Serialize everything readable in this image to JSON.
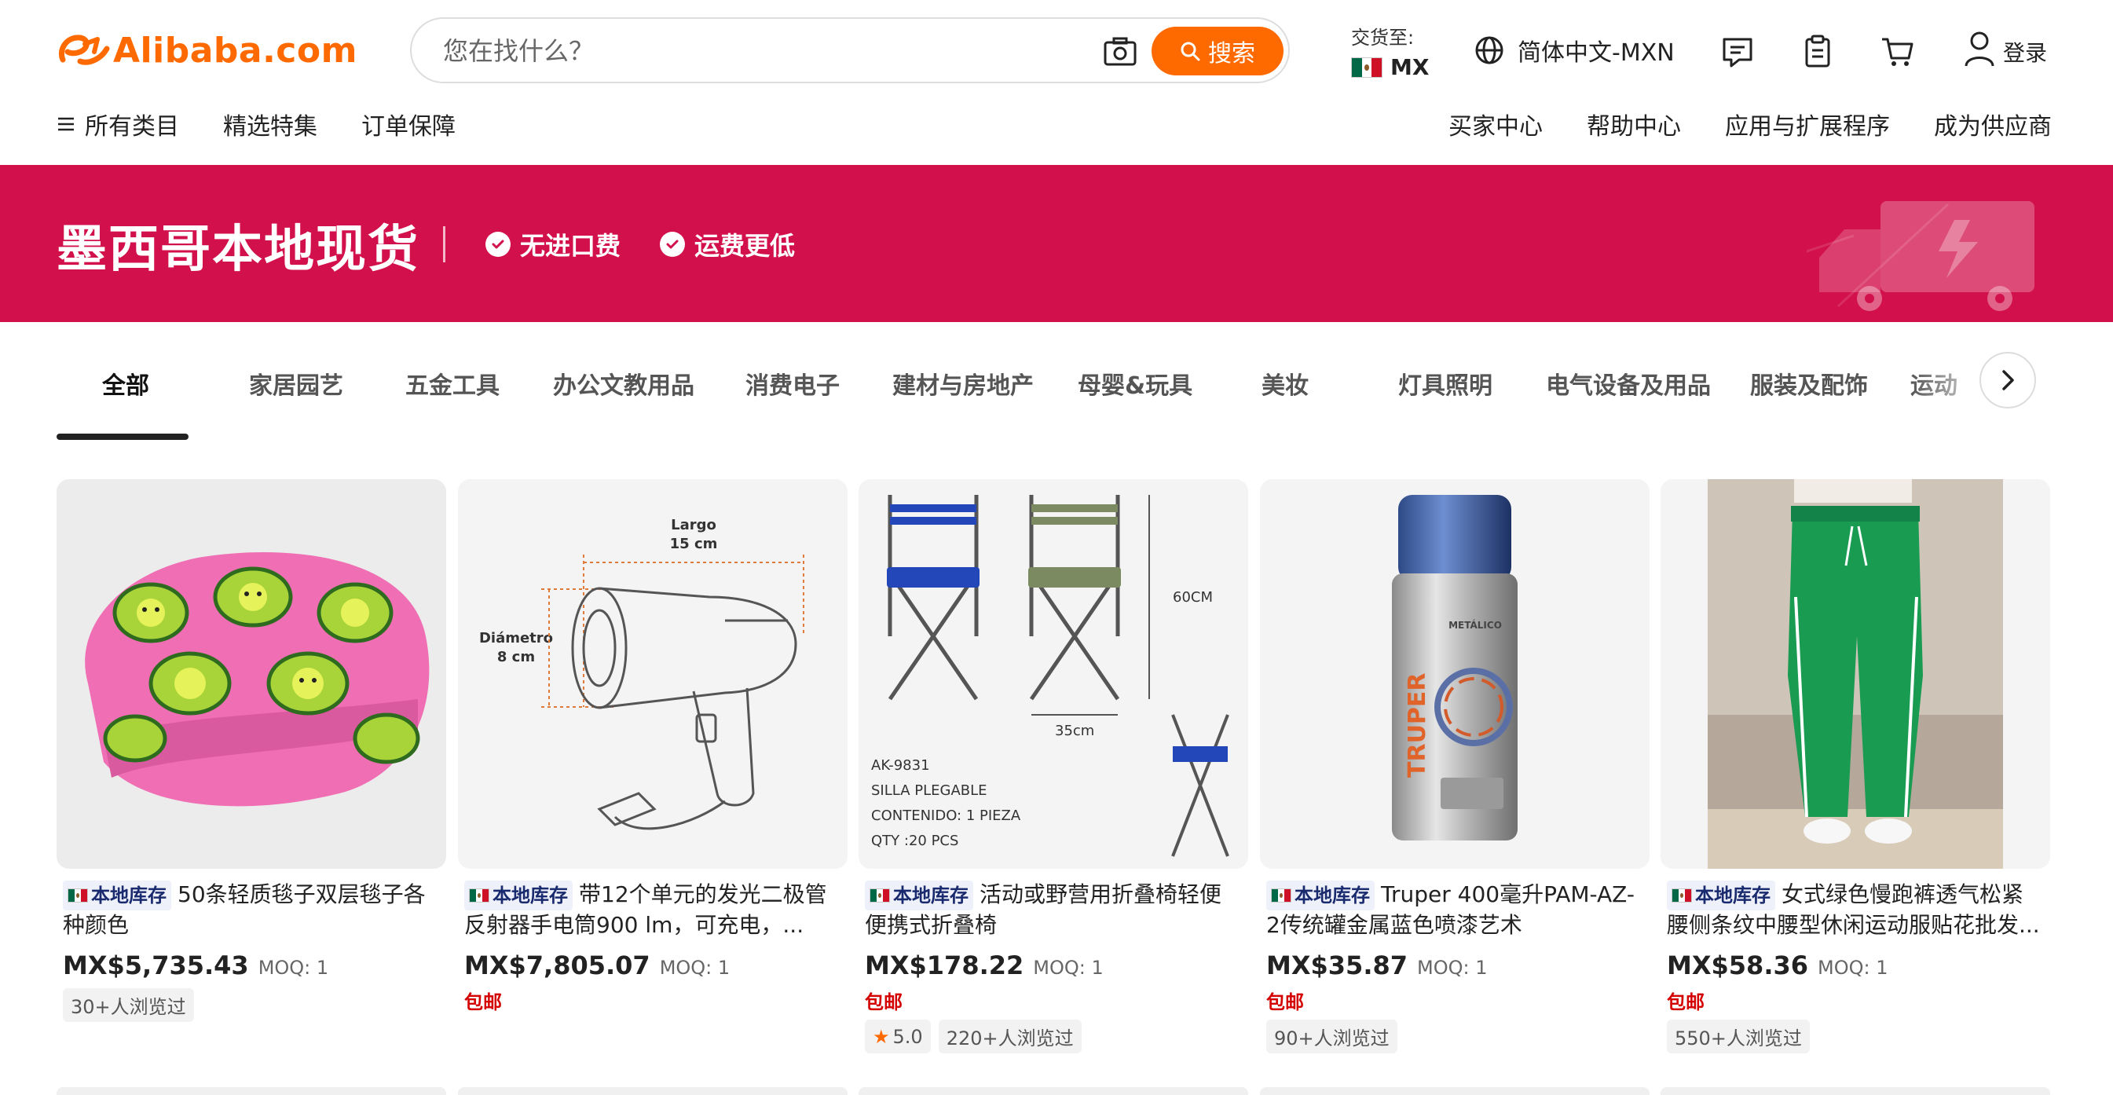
{
  "header": {
    "logo_text": "Alibaba.com",
    "search": {
      "placeholder": "您在找什么？",
      "button_label": "搜索"
    },
    "deliver": {
      "label": "交货至:",
      "country": "MX"
    },
    "language": "简体中文-MXN",
    "login_label": "登录"
  },
  "subnav": {
    "left": [
      "所有类目",
      "精选特集",
      "订单保障"
    ],
    "right": [
      "买家中心",
      "帮助中心",
      "应用与扩展程序",
      "成为供应商"
    ]
  },
  "banner": {
    "title": "墨西哥本地现货",
    "benefits": [
      "无进口费",
      "运费更低"
    ]
  },
  "tabs": [
    "全部",
    "家居园艺",
    "五金工具",
    "办公文教用品",
    "消费电子",
    "建材与房地产",
    "母婴&玩具",
    "美妆",
    "灯具照明",
    "电气设备及用品",
    "服装及配饰",
    "运动"
  ],
  "local_tag": "本地库存",
  "products": [
    {
      "title": "50条轻质毯子双层毯子各种颜色",
      "price": "MX$5,735.43",
      "moq": "MOQ: 1",
      "shipping": "",
      "rating": "",
      "views": "30+人浏览过"
    },
    {
      "title": "带12个单元的发光二极管反射器手电筒900 lm，可充电，...",
      "price": "MX$7,805.07",
      "moq": "MOQ: 1",
      "shipping": "包邮",
      "rating": "",
      "views": ""
    },
    {
      "title": "活动或野营用折叠椅轻便便携式折叠椅",
      "price": "MX$178.22",
      "moq": "MOQ: 1",
      "shipping": "包邮",
      "rating": "5.0",
      "views": "220+人浏览过"
    },
    {
      "title": "Truper 400毫升PAM-AZ-2传统罐金属蓝色喷漆艺术",
      "price": "MX$35.87",
      "moq": "MOQ: 1",
      "shipping": "包邮",
      "rating": "",
      "views": "90+人浏览过"
    },
    {
      "title": "女式绿色慢跑裤透气松紧腰侧条纹中腰型休闲运动服贴花批发...",
      "price": "MX$58.36",
      "moq": "MOQ: 1",
      "shipping": "包邮",
      "rating": "",
      "views": "550+人浏览过"
    }
  ],
  "image_text": {
    "flashlight": {
      "length_label": "Largo",
      "length_value": "15 cm",
      "diameter_label": "Diámetro",
      "diameter_value": "8 cm"
    },
    "chair": {
      "height": "60CM",
      "width": "35cm",
      "lines": [
        "AK-9831",
        "SILLA PLEGABLE",
        "CONTENIDO: 1 PIEZA",
        "QTY :20 PCS"
      ]
    },
    "spray": {
      "brand": "TRUPER",
      "finish": "METÁLICO"
    }
  },
  "colors": {
    "brand_orange": "#ff6a00",
    "banner_red": "#d2104b",
    "shipping_red": "#d40000"
  }
}
